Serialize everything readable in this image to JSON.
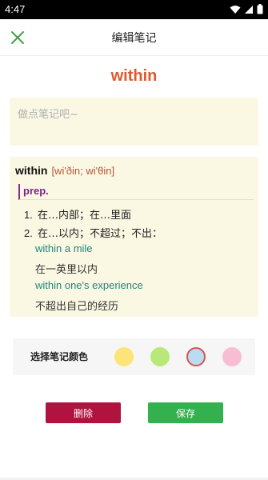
{
  "status_bar": {
    "time": "4:47",
    "icons": [
      "wifi-icon",
      "signal-icon",
      "battery-icon"
    ]
  },
  "app_bar": {
    "title": "编辑笔记",
    "close_icon": "close-icon",
    "accent_color": "#43a047"
  },
  "word": {
    "headword": "within",
    "color": "#dd5a2e"
  },
  "note": {
    "placeholder": "做点笔记吧~",
    "value": ""
  },
  "definition": {
    "word": "within",
    "phonetic": "[wi'ðin; wi'θin]",
    "part_of_speech": "prep.",
    "senses": [
      {
        "num": "1.",
        "text": "在…内部；在…里面"
      },
      {
        "num": "2.",
        "text": "在…以内；不超过；不出："
      }
    ],
    "examples": [
      {
        "en": "within a mile",
        "zh": "在一英里以内"
      },
      {
        "en": "within one's experience",
        "zh": "不超出自己的经历"
      }
    ]
  },
  "note_color": {
    "label": "选择笔记颜色",
    "options": [
      {
        "name": "yellow",
        "color": "#fbe579",
        "selected": false
      },
      {
        "name": "green",
        "color": "#b9e87a",
        "selected": false
      },
      {
        "name": "blue",
        "color": "#b9dcf3",
        "selected": true
      },
      {
        "name": "pink",
        "color": "#f8bcd3",
        "selected": false
      }
    ]
  },
  "actions": {
    "delete_label": "删除",
    "save_label": "保存",
    "delete_color": "#b0133f",
    "save_color": "#33b14e"
  }
}
